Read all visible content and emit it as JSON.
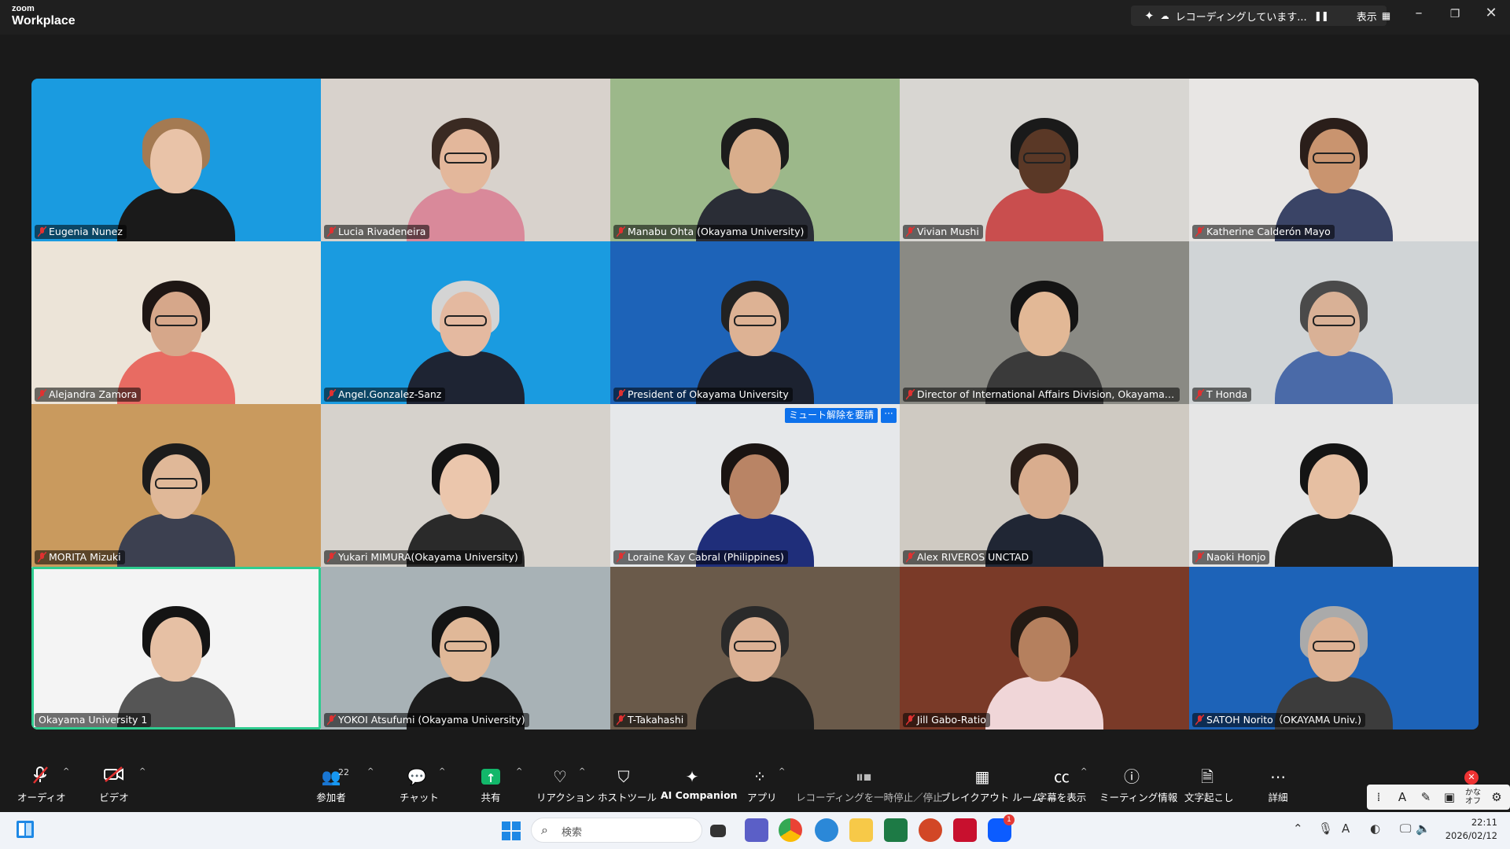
{
  "app": {
    "brand_small": "zoom",
    "brand_large": "Workplace"
  },
  "titlebar": {
    "recording_status": "レコーディングしています...",
    "view_label": "表示"
  },
  "participants": [
    {
      "name": "Eugenia Nunez",
      "bg": "#1a9be0",
      "skin": "#e9c3a8",
      "hair": "#a47a52",
      "shirt": "#1a1a1a",
      "glasses": false
    },
    {
      "name": "Lucia Rivadeneira",
      "bg": "#d8d2cc",
      "skin": "#e3b79b",
      "hair": "#3a2a22",
      "shirt": "#d9899a",
      "glasses": true
    },
    {
      "name": "Manabu Ohta (Okayama University)",
      "bg": "#9cb88a",
      "skin": "#d9ae8c",
      "hair": "#1c1c1c",
      "shirt": "#2a2d36",
      "glasses": false
    },
    {
      "name": "Vivian Mushi",
      "bg": "#d8d6d2",
      "skin": "#5a3826",
      "hair": "#1a1a1a",
      "shirt": "#c94e4e",
      "glasses": true
    },
    {
      "name": "Katherine Calderón Mayo",
      "bg": "#e8e6e4",
      "skin": "#c9946f",
      "hair": "#2a1e1a",
      "shirt": "#3a4466",
      "glasses": true
    },
    {
      "name": "Alejandra Zamora",
      "bg": "#ece4d8",
      "skin": "#d6a78a",
      "hair": "#1e1614",
      "shirt": "#e86b62",
      "glasses": true
    },
    {
      "name": "Angel.Gonzalez-Sanz",
      "bg": "#1a9be0",
      "skin": "#e4b9a0",
      "hair": "#d4d4d4",
      "shirt": "#1e2433",
      "glasses": true
    },
    {
      "name": "President of Okayama University",
      "bg": "#1d63b8",
      "skin": "#ddb294",
      "hair": "#222",
      "shirt": "#1c2230",
      "glasses": true
    },
    {
      "name": "Director of International Affairs Division, Okayama University",
      "bg": "#8a8a84",
      "skin": "#e2b896",
      "hair": "#141414",
      "shirt": "#3a3a3a",
      "glasses": false
    },
    {
      "name": "T Honda",
      "bg": "#d0d4d6",
      "skin": "#d9b196",
      "hair": "#4a4a4a",
      "shirt": "#4a6aa8",
      "glasses": true
    },
    {
      "name": "MORITA Mizuki",
      "bg": "#c99a5e",
      "skin": "#e0b898",
      "hair": "#1c1c1c",
      "shirt": "#3c4050",
      "glasses": true
    },
    {
      "name": "Yukari MIMURA(Okayama University)",
      "bg": "#d6d2cc",
      "skin": "#ebc6ac",
      "hair": "#141414",
      "shirt": "#2a2a2a",
      "glasses": false
    },
    {
      "name": "Loraine Kay Cabral (Philippines)",
      "bg": "#e6e8ea",
      "skin": "#b98465",
      "hair": "#1a1412",
      "shirt": "#1f2e7a",
      "glasses": false,
      "unmute_request": "ミュート解除を要請"
    },
    {
      "name": "Alex RIVEROS UNCTAD",
      "bg": "#cfcac2",
      "skin": "#d9ad8e",
      "hair": "#2a1e18",
      "shirt": "#202634",
      "glasses": false
    },
    {
      "name": "Naoki Honjo",
      "bg": "#e6e6e6",
      "skin": "#e6bfa2",
      "hair": "#141414",
      "shirt": "#1e1e1e",
      "glasses": false
    },
    {
      "name": "Okayama University 1",
      "bg": "#f4f4f4",
      "skin": "#e6c0a4",
      "hair": "#141414",
      "shirt": "#555555",
      "glasses": false,
      "active": true
    },
    {
      "name": "YOKOI Atsufumi (Okayama University)",
      "bg": "#a8b2b6",
      "skin": "#e0b898",
      "hair": "#141414",
      "shirt": "#1c1c1c",
      "glasses": true
    },
    {
      "name": "T-Takahashi",
      "bg": "#6a5a4a",
      "skin": "#dcb194",
      "hair": "#2a2a2a",
      "shirt": "#1e1e1e",
      "glasses": true
    },
    {
      "name": "Jill Gabo-Ratio",
      "bg": "#7a3a28",
      "skin": "#b5805e",
      "hair": "#241a14",
      "shirt": "#f0d6d8",
      "glasses": false
    },
    {
      "name": "SATOH Norito（OKAYAMA Univ.)",
      "bg": "#1d63b8",
      "skin": "#ddb294",
      "hair": "#aaaaaa",
      "shirt": "#3c3c3c",
      "glasses": true
    }
  ],
  "toolbar": {
    "audio": "オーディオ",
    "video": "ビデオ",
    "participants": "参加者",
    "participants_count": "22",
    "chat": "チャット",
    "share": "共有",
    "reactions": "リアクション",
    "host_tools": "ホストツール",
    "ai_companion": "AI Companion",
    "apps": "アプリ",
    "pause_recording": "レコーディングを一時停止／停止",
    "breakout": "ブレイクアウト ルーム",
    "captions": "字幕を表示",
    "meeting_info": "ミーティング情報",
    "transcript": "文字起こし",
    "more": "詳細"
  },
  "ime_panel": {
    "mode": "かな オフ"
  },
  "taskbar": {
    "search_placeholder": "検索",
    "time": "22:11",
    "date": "2026/02/12",
    "zoom_badge": "1"
  }
}
